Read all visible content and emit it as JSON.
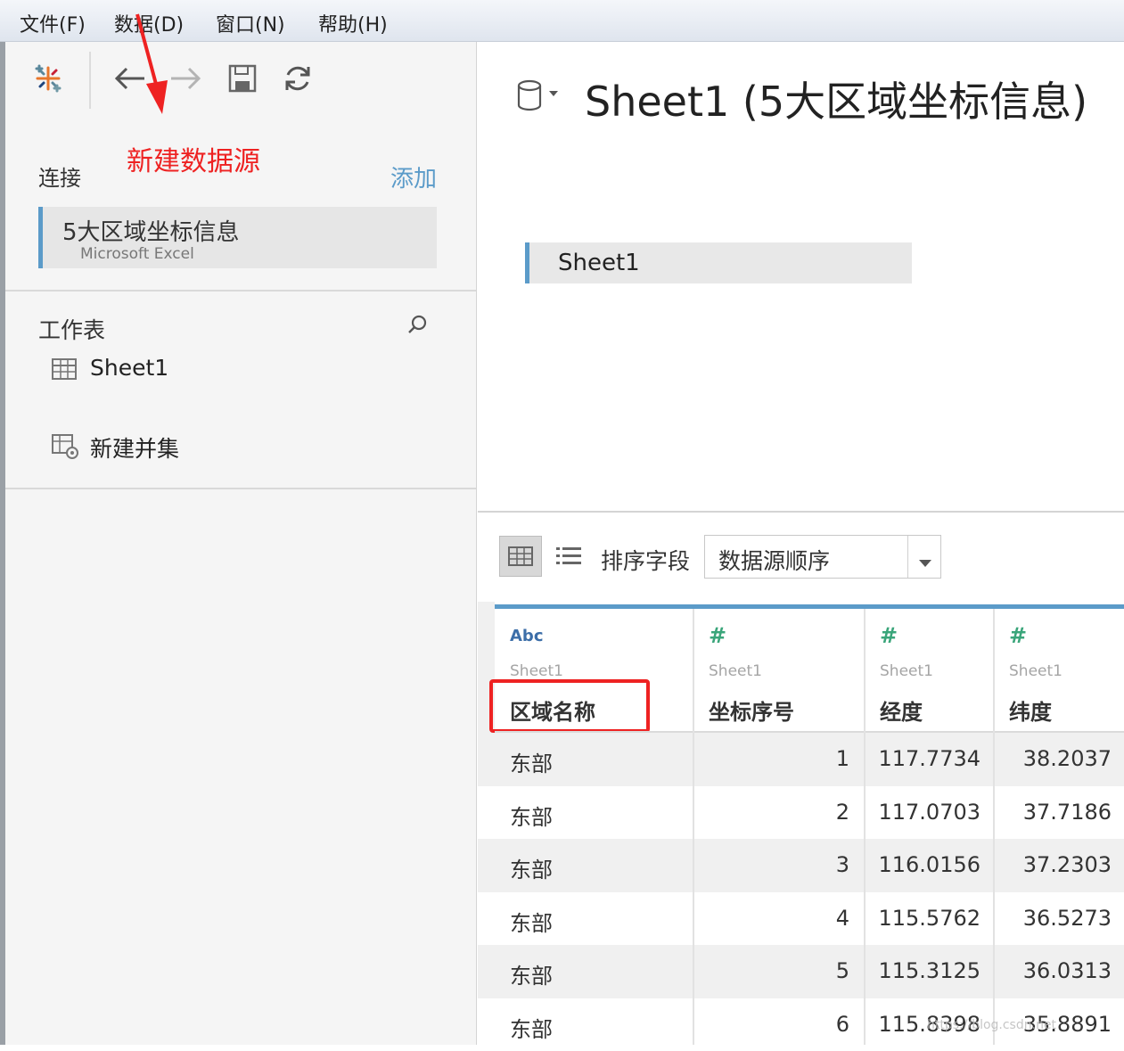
{
  "menu": {
    "items": [
      "文件(F)",
      "数据(D)",
      "窗口(N)",
      "帮助(H)"
    ]
  },
  "annotation": {
    "label": "新建数据源",
    "color": "#ee2222"
  },
  "connections": {
    "heading": "连接",
    "add_label": "添加",
    "item": {
      "name": "5大区域坐标信息",
      "type": "Microsoft Excel"
    }
  },
  "worksheets": {
    "heading": "工作表",
    "items": [
      "Sheet1"
    ],
    "new_union": "新建并集"
  },
  "canvas": {
    "title": "Sheet1 (5大区域坐标信息)",
    "table_pill": "Sheet1"
  },
  "grid_toolbar": {
    "sort_label": "排序字段",
    "sort_value": "数据源顺序"
  },
  "grid": {
    "columns": [
      {
        "type_icon": "Abc",
        "source": "Sheet1",
        "name": "区域名称"
      },
      {
        "type_icon": "#",
        "source": "Sheet1",
        "name": "坐标序号"
      },
      {
        "type_icon": "#",
        "source": "Sheet1",
        "name": "经度"
      },
      {
        "type_icon": "#",
        "source": "Sheet1",
        "name": "纬度"
      }
    ],
    "rows": [
      [
        "东部",
        "1",
        "117.7734",
        "38.2037"
      ],
      [
        "东部",
        "2",
        "117.0703",
        "37.7186"
      ],
      [
        "东部",
        "3",
        "116.0156",
        "37.2303"
      ],
      [
        "东部",
        "4",
        "115.5762",
        "36.5273"
      ],
      [
        "东部",
        "5",
        "115.3125",
        "36.0313"
      ],
      [
        "东部",
        "6",
        "115.8398",
        "35.8891"
      ]
    ]
  },
  "colors": {
    "accent_blue": "#5b9bc9",
    "number_icon_green": "#3aa57a",
    "abc_icon_blue": "#3c6ea8"
  }
}
